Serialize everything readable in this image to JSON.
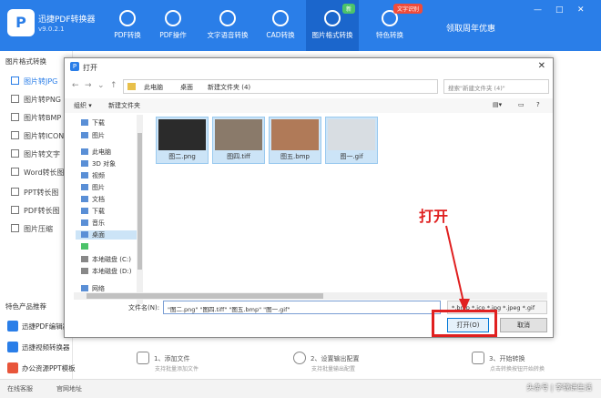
{
  "app": {
    "logo": "P",
    "name": "迅捷PDF转换器",
    "version": "v9.0.2.1",
    "promo": "领取周年优惠"
  },
  "nav": {
    "tabs": [
      "PDF转换",
      "PDF操作",
      "文字语音转换",
      "CAD转换",
      "图片格式转换",
      "特色转换"
    ],
    "badge_new": "新",
    "badge_hot": "文字识别"
  },
  "window": {
    "controls": [
      "—",
      "□",
      "✕"
    ]
  },
  "sidebar": {
    "title": "图片格式转换",
    "items": [
      "图片转JPG",
      "图片转PNG",
      "图片转BMP",
      "图片转ICON",
      "图片转文字",
      "Word转长图",
      "PPT转长图",
      "PDF转长图",
      "图片压缩"
    ]
  },
  "products": {
    "title": "特色产品推荐",
    "items": [
      "迅捷PDF编辑器",
      "迅捷视频转换器",
      "办公资源PPT模板"
    ]
  },
  "footer": {
    "items": [
      "在线客服",
      "官网地址"
    ]
  },
  "steps": [
    {
      "title": "1、添加文件",
      "sub": "支持批量添加文件"
    },
    {
      "title": "2、设置输出配置",
      "sub": "支持批量输出配置"
    },
    {
      "title": "3、开始转换",
      "sub": "点击转换按钮开始转换"
    }
  ],
  "dialog": {
    "title": "打开",
    "breadcrumb": [
      "此电脑",
      "桌面",
      "新建文件夹 (4)"
    ],
    "search_placeholder": "搜索\"新建文件夹 (4)\"",
    "cmd": {
      "organize": "组织 ▾",
      "new_folder": "新建文件夹"
    },
    "tree": [
      "下载",
      "图片",
      "此电脑",
      "3D 对象",
      "视频",
      "图片",
      "文档",
      "下载",
      "音乐",
      "桌面",
      "",
      "本地磁盘 (C:)",
      "本地磁盘 (D:)",
      "网络"
    ],
    "files": [
      "图二.png",
      "图四.tiff",
      "图五.bmp",
      "图一.gif"
    ],
    "filename_label": "文件名(N):",
    "filename_value": "\"图二.png\" \"图四.tiff\" \"图五.bmp\" \"图一.gif\"",
    "filetype_value": "*.bmp *.ico *.jpg *.jpeg *.gif",
    "open_button": "打开(O)",
    "cancel_button": "取消"
  },
  "annotation": {
    "label": "打开"
  },
  "watermark": "头条号 | 李锦讲生活"
}
